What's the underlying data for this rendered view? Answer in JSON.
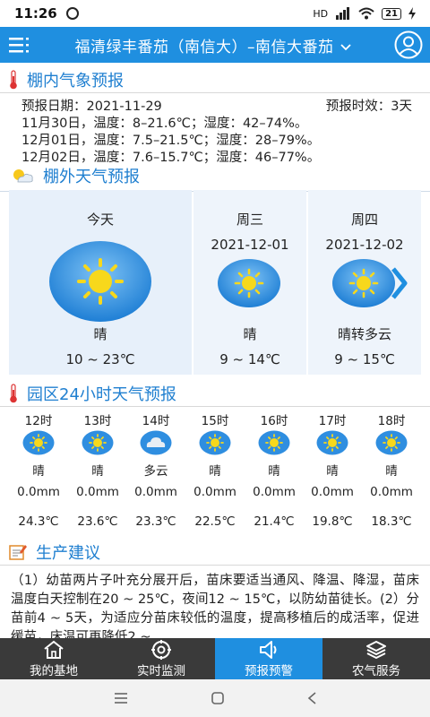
{
  "status": {
    "time": "11:26",
    "network": "HD",
    "battery": "21"
  },
  "header": {
    "title": "福清绿丰番茄（南信大）–南信大番茄"
  },
  "greenhouse": {
    "title": "棚内气象预报",
    "date_label": "预报日期：2021-11-29",
    "validity": "预报时效：3天",
    "lines": [
      "11月30日，温度：8–21.6℃；湿度：42–74%。",
      "12月01日，温度：7.5–21.5℃；湿度：28–79%。",
      "12月02日，温度：7.6–15.7℃；湿度：46–77%。"
    ]
  },
  "outdoor": {
    "title": "棚外天气预报",
    "days": [
      {
        "day": "今天",
        "date": "",
        "cond": "晴",
        "temp": "10 ~ 23℃"
      },
      {
        "day": "周三",
        "date": "2021-12-01",
        "cond": "晴",
        "temp": "9 ~ 14℃"
      },
      {
        "day": "周四",
        "date": "2021-12-02",
        "cond": "晴转多云",
        "temp": "9 ~ 15℃"
      }
    ]
  },
  "hourly": {
    "title": "园区24小时天气预报",
    "items": [
      {
        "time": "12时",
        "icon": "sun-icon",
        "cond": "晴",
        "rain": "0.0mm",
        "temp": "24.3℃"
      },
      {
        "time": "13时",
        "icon": "sun-icon",
        "cond": "晴",
        "rain": "0.0mm",
        "temp": "23.6℃"
      },
      {
        "time": "14时",
        "icon": "cloud-icon",
        "cond": "多云",
        "rain": "0.0mm",
        "temp": "23.3℃"
      },
      {
        "time": "15时",
        "icon": "sun-icon",
        "cond": "晴",
        "rain": "0.0mm",
        "temp": "22.5℃"
      },
      {
        "time": "16时",
        "icon": "sun-icon",
        "cond": "晴",
        "rain": "0.0mm",
        "temp": "21.4℃"
      },
      {
        "time": "17时",
        "icon": "sun-icon",
        "cond": "晴",
        "rain": "0.0mm",
        "temp": "19.8℃"
      },
      {
        "time": "18时",
        "icon": "sun-icon",
        "cond": "晴",
        "rain": "0.0mm",
        "temp": "18.3℃"
      }
    ]
  },
  "advice": {
    "title": "生产建议",
    "text": "（1）幼苗两片子叶充分展开后，苗床要适当通风、降温、降湿，苗床温度白天控制在20 ~ 25℃，夜间12 ~ 15℃，以防幼苗徒长。(2）分苗前4 ~ 5天，为适应分苗床较低的温度，提高移植后的成活率，促进缓苗，床温可再降低2 ~"
  },
  "nav": {
    "items": [
      {
        "label": "我的基地",
        "icon": "home-icon"
      },
      {
        "label": "实时监测",
        "icon": "monitor-icon"
      },
      {
        "label": "预报预警",
        "icon": "alert-icon"
      },
      {
        "label": "农气服务",
        "icon": "layers-icon"
      }
    ],
    "active": "预报预警"
  },
  "colors": {
    "primary": "#1f8fe0",
    "nav_bg": "#3a3a3a",
    "title_blue": "#1f7fd0",
    "sun": "#f7d81c",
    "sky": "#2f8ee0"
  }
}
